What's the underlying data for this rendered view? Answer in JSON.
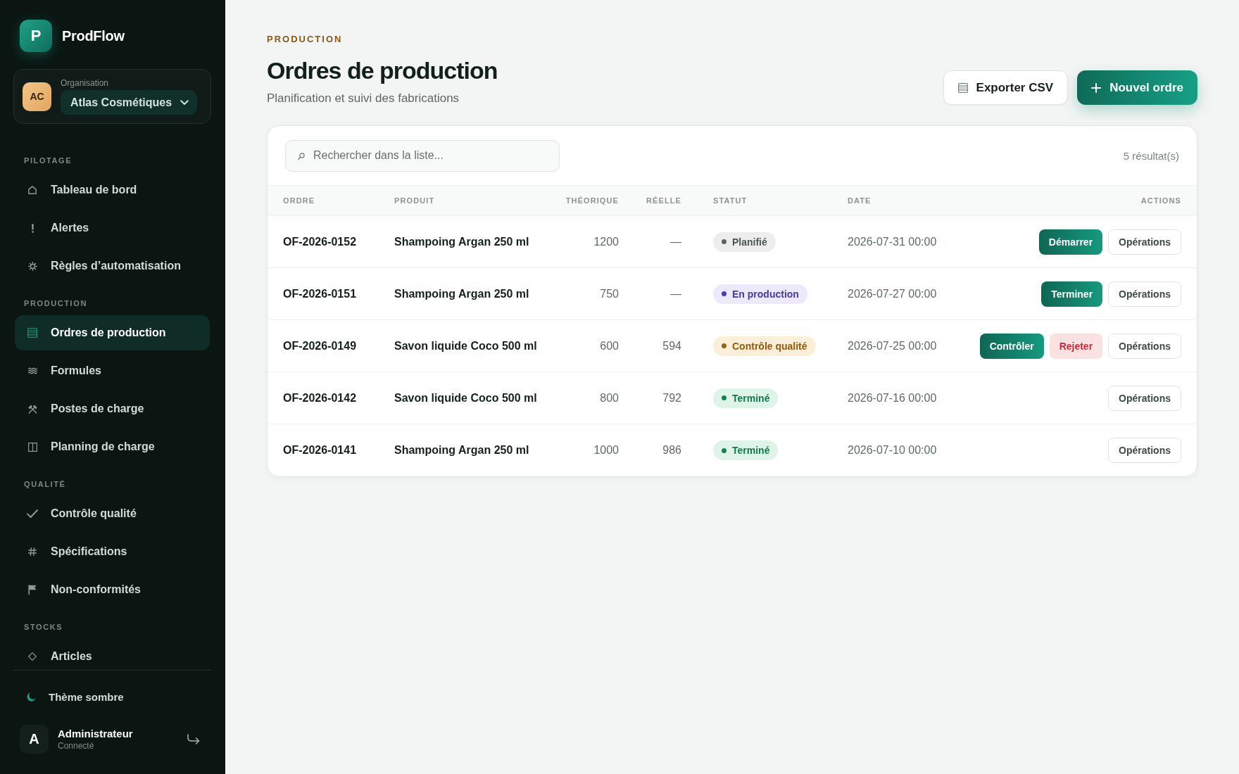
{
  "sidebar": {
    "brand": {
      "logo_text": "P",
      "name": "ProdFlow"
    },
    "organization": {
      "avatar": "AC",
      "label": "Organisation",
      "value": "Atlas Cosmétiques"
    },
    "sections": [
      {
        "title": "PILOTAGE",
        "items": [
          {
            "label": "Tableau de bord",
            "selected": false
          },
          {
            "label": "Alertes",
            "selected": false
          },
          {
            "label": "Règles d’automatisation",
            "selected": false
          }
        ]
      },
      {
        "title": "PRODUCTION",
        "items": [
          {
            "label": "Ordres de production",
            "selected": true
          },
          {
            "label": "Formules",
            "selected": false
          },
          {
            "label": "Postes de charge",
            "selected": false
          },
          {
            "label": "Planning de charge",
            "selected": false
          }
        ]
      },
      {
        "title": "QUALITÉ",
        "items": [
          {
            "label": "Contrôle qualité",
            "selected": false
          },
          {
            "label": "Spécifications",
            "selected": false
          },
          {
            "label": "Non-conformités",
            "selected": false
          }
        ]
      },
      {
        "title": "STOCKS",
        "items": [
          {
            "label": "Articles",
            "selected": false
          }
        ]
      }
    ],
    "theme_toggle": {
      "label": "Thème sombre"
    },
    "user": {
      "avatar": "A",
      "name": "Administrateur",
      "status": "Connecté"
    }
  },
  "header": {
    "eyebrow": "PRODUCTION",
    "title": "Ordres de production",
    "subtitle": "Planification et suivi des fabrications",
    "actions": [
      {
        "label": "Exporter CSV",
        "kind": "secondary"
      },
      {
        "label": "Nouvel ordre",
        "kind": "primary"
      }
    ]
  },
  "table": {
    "search": {
      "placeholder": "Rechercher dans la liste..."
    },
    "result_count": "5 résultat(s)",
    "columns": [
      "ORDRE",
      "PRODUIT",
      "THÉORIQUE",
      "RÉELLE",
      "STATUT",
      "DATE",
      "ACTIONS"
    ],
    "rows": [
      {
        "order": "OF-2026-0152",
        "product": "Shampoing Argan 250 ml",
        "planned": "1200",
        "actual": "—",
        "status": {
          "label": "Planifié",
          "kind": "planned"
        },
        "date": "2026-07-31 00:00",
        "actions": [
          {
            "label": "Démarrer",
            "kind": "primary"
          },
          {
            "label": "Opérations",
            "kind": "secondary"
          }
        ]
      },
      {
        "order": "OF-2026-0151",
        "product": "Shampoing Argan 250 ml",
        "planned": "750",
        "actual": "—",
        "status": {
          "label": "En production",
          "kind": "running"
        },
        "date": "2026-07-27 00:00",
        "actions": [
          {
            "label": "Terminer",
            "kind": "primary"
          },
          {
            "label": "Opérations",
            "kind": "secondary"
          }
        ]
      },
      {
        "order": "OF-2026-0149",
        "product": "Savon liquide Coco 500 ml",
        "planned": "600",
        "actual": "594",
        "status": {
          "label": "Contrôle qualité",
          "kind": "inspection"
        },
        "date": "2026-07-25 00:00",
        "actions": [
          {
            "label": "Contrôler",
            "kind": "primary"
          },
          {
            "label": "Rejeter",
            "kind": "danger"
          },
          {
            "label": "Opérations",
            "kind": "secondary"
          }
        ]
      },
      {
        "order": "OF-2026-0142",
        "product": "Savon liquide Coco 500 ml",
        "planned": "800",
        "actual": "792",
        "status": {
          "label": "Terminé",
          "kind": "done"
        },
        "date": "2026-07-16 00:00",
        "actions": [
          {
            "label": "Opérations",
            "kind": "secondary"
          }
        ]
      },
      {
        "order": "OF-2026-0141",
        "product": "Shampoing Argan 250 ml",
        "planned": "1000",
        "actual": "986",
        "status": {
          "label": "Terminé",
          "kind": "done"
        },
        "date": "2026-07-10 00:00",
        "actions": [
          {
            "label": "Opérations",
            "kind": "secondary"
          }
        ]
      }
    ]
  }
}
